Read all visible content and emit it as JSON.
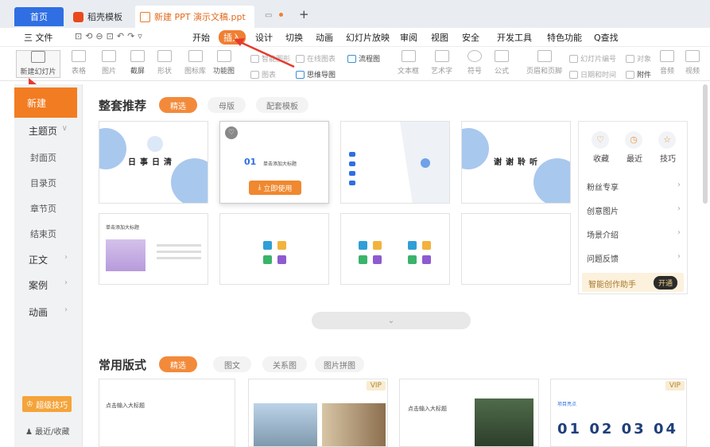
{
  "tabs": {
    "home": "首页",
    "docer": "稻壳模板",
    "file": "新建 PPT 演示文稿.ppt",
    "add": "+"
  },
  "menu": {
    "file": "三 文件",
    "items": [
      "开始",
      "插入",
      "设计",
      "切换",
      "动画",
      "幻灯片放映",
      "审阅",
      "视图",
      "安全",
      "开发工具",
      "特色功能"
    ],
    "search": "Q查找"
  },
  "toolbar": {
    "new_slide": "新建幻灯片",
    "table": "表格",
    "picture": "图片",
    "screenshot": "截屏",
    "shape": "形状",
    "icon_lib": "图标库",
    "func_chart": "功能图",
    "chart": "图表",
    "smart_shape": "智能图形",
    "online_chart": "在线图表",
    "flowchart": "流程图",
    "mindmap": "思维导图",
    "textbox": "文本框",
    "art_text": "艺术字",
    "symbol": "符号",
    "formula": "公式",
    "header_footer": "页眉和页脚",
    "slide_number": "幻灯片编号",
    "object": "对象",
    "datetime": "日期和时间",
    "attachment": "附件",
    "audio": "音频",
    "video": "视频"
  },
  "sidebar": {
    "new": "新建",
    "theme": "主题页",
    "cover": "封面页",
    "toc": "目录页",
    "chapter": "章节页",
    "end": "结束页",
    "body": "正文",
    "case": "案例",
    "anim": "动画",
    "tips": "超级技巧",
    "recent": "最近/收藏"
  },
  "section1": {
    "title": "整套推荐",
    "pills": [
      "精选",
      "母版",
      "配套模板"
    ]
  },
  "thumbs": {
    "t1_title": "日事日清",
    "t2_num": "01",
    "t2_title": "单击添加大标题",
    "t2_use": "立即使用",
    "t4_title": "谢谢聆听",
    "t5_head": "单击添加大标题"
  },
  "side_panel": {
    "collect": "收藏",
    "recent": "最近",
    "tips": "技巧",
    "rows": [
      "粉丝专享",
      "创意图片",
      "场景介绍",
      "问题反馈"
    ],
    "assistant": "智能创作助手",
    "open": "开通"
  },
  "section2": {
    "title": "常用版式",
    "pills": [
      "精选",
      "图文",
      "关系图",
      "图片拼图"
    ],
    "t1": "点击输入大标题",
    "t3": "点击输入大标题",
    "t4_head": "项目亮点",
    "t4_nums": "01 02 03 04",
    "vip": "VIP"
  },
  "colors": {
    "accent": "#f27c22",
    "tab_blue": "#2f6fe3",
    "thumb_blue": "#a9c8ee"
  }
}
